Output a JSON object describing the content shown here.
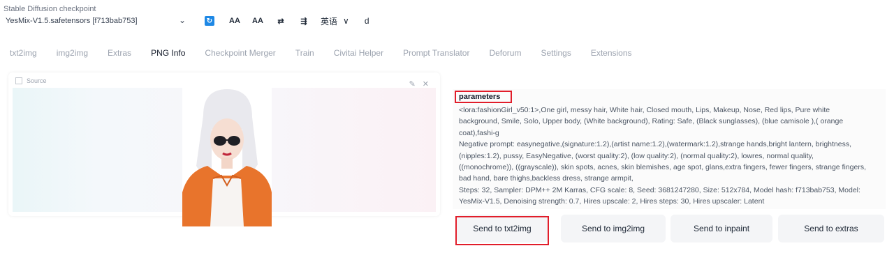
{
  "checkpoint": {
    "label": "Stable Diffusion checkpoint",
    "value": "YesMix-V1.5.safetensors [f713bab753]"
  },
  "toolbar": {
    "tool2": "AA",
    "tool3": "AA",
    "tool4": "⇄",
    "tool5": "⇶",
    "language": "英语",
    "language_chevron": "∨",
    "extra_text": "d"
  },
  "tabs": [
    "txt2img",
    "img2img",
    "Extras",
    "PNG Info",
    "Checkpoint Merger",
    "Train",
    "Civitai Helper",
    "Prompt Translator",
    "Deforum",
    "Settings",
    "Extensions"
  ],
  "active_tab": "PNG Info",
  "source": {
    "label": "Source"
  },
  "parameters": {
    "title": "parameters",
    "lines": [
      "<lora:fashionGirl_v50:1>,One girl, messy hair, White hair, Closed mouth, Lips, Makeup, Nose, Red lips, Pure white",
      "background, Smile, Solo, Upper body, (White background), Rating: Safe, (Black sunglasses), (blue camisole ),( orange",
      "coat),fashi-g",
      "Negative prompt: easynegative,(signature:1.2),(artist name:1.2),(watermark:1.2),strange hands,bright lantern, brightness,",
      "(nipples:1.2), pussy, EasyNegative, (worst quality:2), (low quality:2), (normal quality:2), lowres, normal quality,",
      "((monochrome)), ((grayscale)), skin spots, acnes, skin blemishes, age spot, glans,extra fingers, fewer fingers, strange fingers,",
      "bad hand, bare thighs,backless dress, strange armpit,",
      "Steps: 32, Sampler: DPM++ 2M Karras, CFG scale: 8, Seed: 3681247280, Size: 512x784, Model hash: f713bab753, Model:",
      "YesMix-V1.5, Denoising strength: 0.7, Hires upscale: 2, Hires steps: 30, Hires upscaler: Latent"
    ]
  },
  "buttons": {
    "send_txt2img": "Send to txt2img",
    "send_img2img": "Send to img2img",
    "send_inpaint": "Send to inpaint",
    "send_extras": "Send to extras"
  },
  "colors": {
    "highlight": "#e11d2a",
    "refresh": "#1e88e5"
  }
}
